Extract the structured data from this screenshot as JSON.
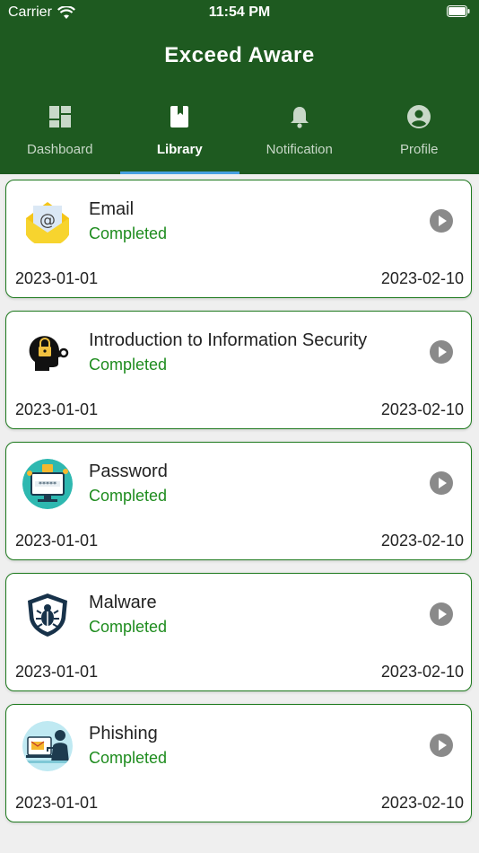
{
  "status_bar": {
    "carrier": "Carrier",
    "time": "11:54 PM"
  },
  "header": {
    "title": "Exceed Aware"
  },
  "tabs": [
    {
      "label": "Dashboard",
      "icon": "dashboard-icon"
    },
    {
      "label": "Library",
      "icon": "book-icon",
      "active": true
    },
    {
      "label": "Notification",
      "icon": "bell-icon"
    },
    {
      "label": "Profile",
      "icon": "account-circle-icon"
    }
  ],
  "courses": [
    {
      "title": "Email",
      "status": "Completed",
      "start": "2023-01-01",
      "end": "2023-02-10",
      "icon": "email-envelope-icon"
    },
    {
      "title": "Introduction to Information Security",
      "status": "Completed",
      "start": "2023-01-01",
      "end": "2023-02-10",
      "icon": "head-lock-key-icon"
    },
    {
      "title": "Password",
      "status": "Completed",
      "start": "2023-01-01",
      "end": "2023-02-10",
      "icon": "password-screen-icon"
    },
    {
      "title": "Malware",
      "status": "Completed",
      "start": "2023-01-01",
      "end": "2023-02-10",
      "icon": "bug-shield-icon"
    },
    {
      "title": "Phishing",
      "status": "Completed",
      "start": "2023-01-01",
      "end": "2023-02-10",
      "icon": "phishing-hacker-icon"
    }
  ],
  "colors": {
    "appbar": "#1e5a20",
    "status_text": "#1e8c1e",
    "tab_indicator": "#46a0e0",
    "card_border": "#1e7a1e"
  }
}
